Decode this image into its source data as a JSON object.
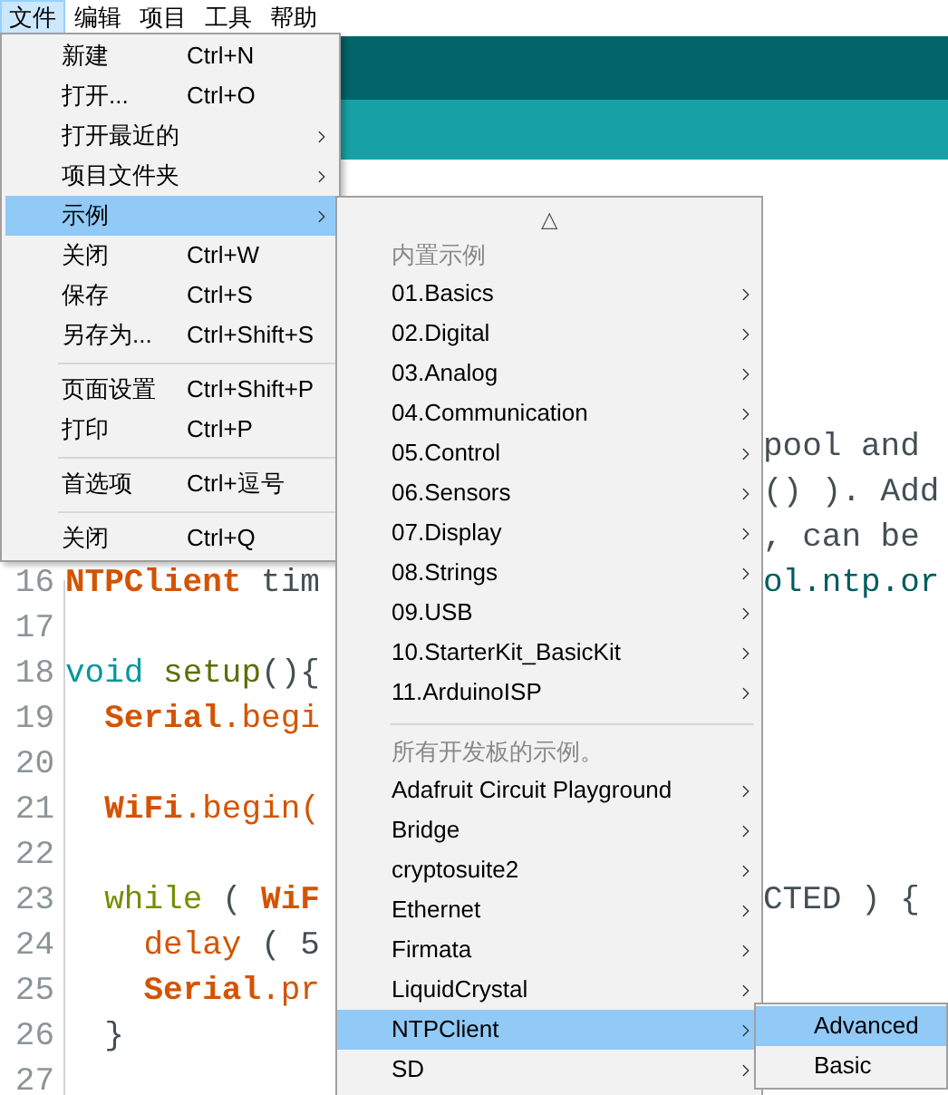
{
  "menubar": [
    {
      "label": "文件",
      "selected": true
    },
    {
      "label": "编辑",
      "selected": false
    },
    {
      "label": "项目",
      "selected": false
    },
    {
      "label": "工具",
      "selected": false
    },
    {
      "label": "帮助",
      "selected": false
    }
  ],
  "editor": {
    "lines": [
      {
        "right": [
          {
            "text": "pool and",
            "kind": "plain"
          }
        ]
      },
      {
        "right": [
          {
            "text": "() ). Add",
            "kind": "plain"
          }
        ]
      },
      {
        "right": [
          {
            "text": ", can be",
            "kind": "plain"
          }
        ]
      },
      {
        "number": "16",
        "left": [
          {
            "text": "NTPClient",
            "kind": "class"
          },
          {
            "text": " tim",
            "kind": "plain"
          }
        ],
        "right": [
          {
            "text": "ol.ntp.or",
            "kind": "string"
          }
        ]
      },
      {
        "number": "17"
      },
      {
        "number": "18",
        "left": [
          {
            "text": "void",
            "kind": "type"
          },
          {
            "text": " setup",
            "kind": "function"
          },
          {
            "text": "(){",
            "kind": "plain"
          }
        ]
      },
      {
        "number": "19",
        "left": [
          {
            "text": "  Serial",
            "kind": "class"
          },
          {
            "text": ".begi",
            "kind": "method"
          }
        ]
      },
      {
        "number": "20"
      },
      {
        "number": "21",
        "left": [
          {
            "text": "  WiFi",
            "kind": "class"
          },
          {
            "text": ".begin(",
            "kind": "method"
          }
        ]
      },
      {
        "number": "22"
      },
      {
        "number": "23",
        "left": [
          {
            "text": "  while",
            "kind": "control"
          },
          {
            "text": " ( ",
            "kind": "plain"
          },
          {
            "text": "WiF",
            "kind": "class"
          }
        ],
        "right": [
          {
            "text": "CTED ) {",
            "kind": "plain"
          }
        ]
      },
      {
        "number": "24",
        "left": [
          {
            "text": "    delay",
            "kind": "method"
          },
          {
            "text": " ( 5",
            "kind": "plain"
          }
        ]
      },
      {
        "number": "25",
        "left": [
          {
            "text": "    Serial",
            "kind": "class"
          },
          {
            "text": ".pr",
            "kind": "method"
          }
        ]
      },
      {
        "number": "26",
        "left": [
          {
            "text": "  }",
            "kind": "plain"
          }
        ]
      },
      {
        "number": "27"
      }
    ]
  },
  "file_menu": {
    "items": [
      {
        "kind": "item",
        "label": "新建",
        "shortcut": "Ctrl+N",
        "selected": false
      },
      {
        "kind": "item",
        "label": "打开...",
        "shortcut": "Ctrl+O",
        "selected": false
      },
      {
        "kind": "submenu",
        "label": "打开最近的",
        "selected": false
      },
      {
        "kind": "submenu",
        "label": "项目文件夹",
        "selected": false
      },
      {
        "kind": "submenu",
        "label": "示例",
        "selected": true
      },
      {
        "kind": "item",
        "label": "关闭",
        "shortcut": "Ctrl+W",
        "selected": false
      },
      {
        "kind": "item",
        "label": "保存",
        "shortcut": "Ctrl+S",
        "selected": false
      },
      {
        "kind": "item",
        "label": "另存为...",
        "shortcut": "Ctrl+Shift+S",
        "selected": false
      },
      {
        "kind": "separator"
      },
      {
        "kind": "item",
        "label": "页面设置",
        "shortcut": "Ctrl+Shift+P",
        "selected": false
      },
      {
        "kind": "item",
        "label": "打印",
        "shortcut": "Ctrl+P",
        "selected": false
      },
      {
        "kind": "separator"
      },
      {
        "kind": "item",
        "label": "首选项",
        "shortcut": "Ctrl+逗号",
        "selected": false
      },
      {
        "kind": "separator"
      },
      {
        "kind": "item",
        "label": "关闭",
        "shortcut": "Ctrl+Q",
        "selected": false
      }
    ]
  },
  "examples_menu": {
    "scroll_arrow": "△",
    "sections": [
      {
        "header": "内置示例",
        "items": [
          {
            "label": "01.Basics",
            "selected": false
          },
          {
            "label": "02.Digital",
            "selected": false
          },
          {
            "label": "03.Analog",
            "selected": false
          },
          {
            "label": "04.Communication",
            "selected": false
          },
          {
            "label": "05.Control",
            "selected": false
          },
          {
            "label": "06.Sensors",
            "selected": false
          },
          {
            "label": "07.Display",
            "selected": false
          },
          {
            "label": "08.Strings",
            "selected": false
          },
          {
            "label": "09.USB",
            "selected": false
          },
          {
            "label": "10.StarterKit_BasicKit",
            "selected": false
          },
          {
            "label": "11.ArduinoISP",
            "selected": false
          }
        ]
      },
      {
        "header": "所有开发板的示例。",
        "items": [
          {
            "label": "Adafruit Circuit Playground",
            "selected": false
          },
          {
            "label": "Bridge",
            "selected": false
          },
          {
            "label": "cryptosuite2",
            "selected": false
          },
          {
            "label": "Ethernet",
            "selected": false
          },
          {
            "label": "Firmata",
            "selected": false
          },
          {
            "label": "LiquidCrystal",
            "selected": false
          },
          {
            "label": "NTPClient",
            "selected": true
          },
          {
            "label": "SD",
            "selected": false
          }
        ]
      }
    ]
  },
  "ntp_menu": {
    "items": [
      {
        "label": "Advanced",
        "selected": true
      },
      {
        "label": "Basic",
        "selected": false
      }
    ]
  }
}
